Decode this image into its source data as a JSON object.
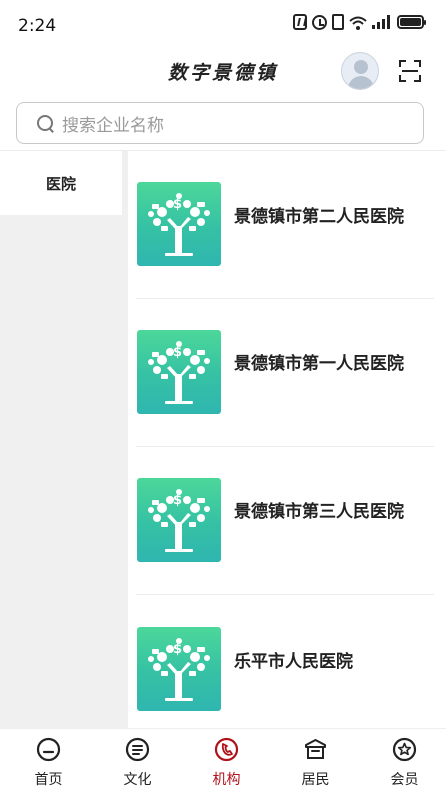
{
  "status_bar": {
    "time": "2:24",
    "icons": [
      "nfc-icon",
      "alarm-icon",
      "vibrate-icon",
      "wifi-icon",
      "signal-icon",
      "battery-icon"
    ]
  },
  "header": {
    "title": "数字景德镇",
    "avatar_icon": "user-avatar-icon",
    "scan_icon": "scan-icon"
  },
  "search": {
    "placeholder": "搜索企业名称"
  },
  "sidebar": {
    "items": [
      {
        "label": "医院",
        "selected": true
      }
    ]
  },
  "list": {
    "items": [
      {
        "name": "景德镇市第二人民医院",
        "thumb_icon": "money-tree-icon"
      },
      {
        "name": "景德镇市第一人民医院",
        "thumb_icon": "money-tree-icon"
      },
      {
        "name": "景德镇市第三人民医院",
        "thumb_icon": "money-tree-icon"
      },
      {
        "name": "乐平市人民医院",
        "thumb_icon": "money-tree-icon"
      }
    ]
  },
  "tabbar": {
    "tabs": [
      {
        "label": "首页",
        "icon": "home-icon",
        "active": false
      },
      {
        "label": "文化",
        "icon": "culture-icon",
        "active": false
      },
      {
        "label": "机构",
        "icon": "institution-icon",
        "active": true
      },
      {
        "label": "居民",
        "icon": "resident-icon",
        "active": false
      },
      {
        "label": "会员",
        "icon": "member-icon",
        "active": false
      }
    ]
  },
  "colors": {
    "accent": "#b0121b",
    "thumb_gradient_top": "#4cd79a",
    "thumb_gradient_bottom": "#2fb6b0",
    "sidebar_bg": "#f0f0f0"
  }
}
